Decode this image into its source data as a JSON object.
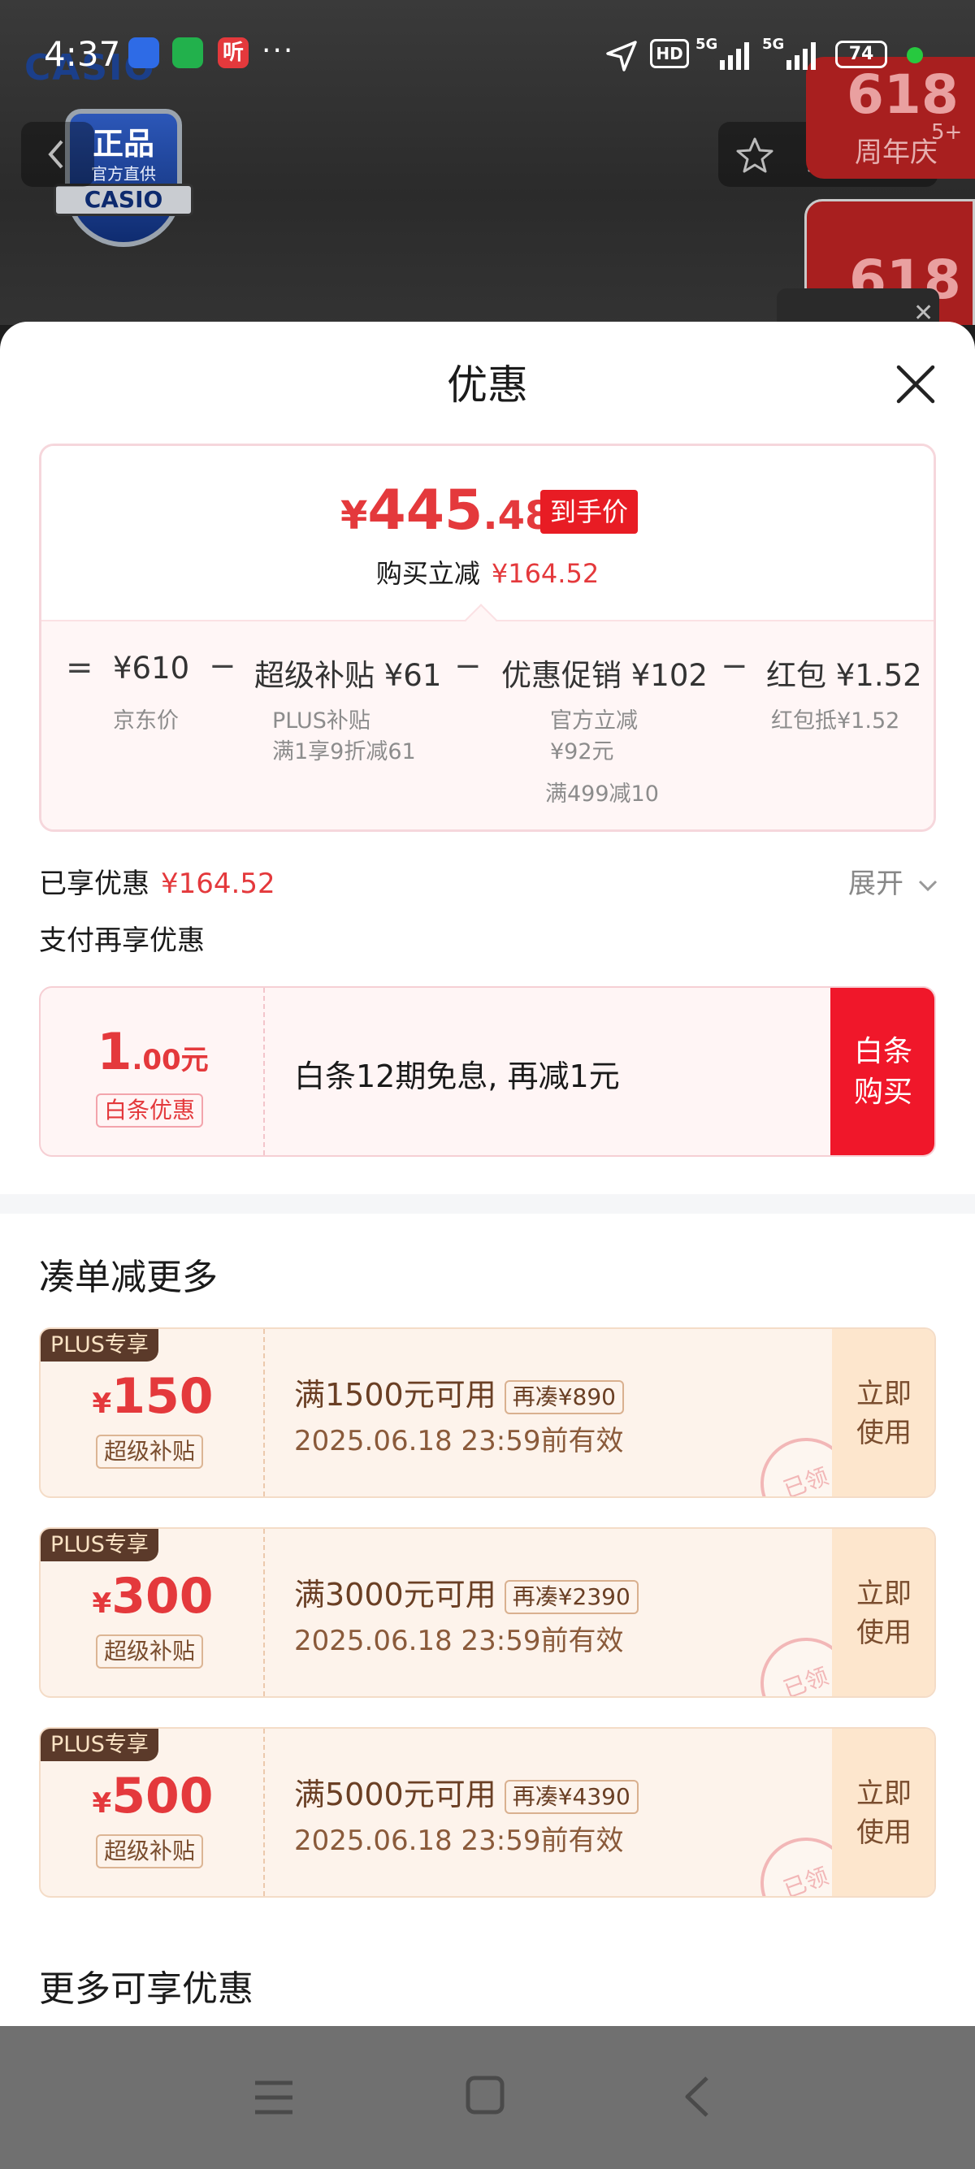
{
  "status_bar": {
    "time": "4:37",
    "hd_label": "HD",
    "network_1": "5G",
    "network_2": "5G",
    "battery": "74",
    "extra_icons": "···",
    "ting_icon_text": "听"
  },
  "background": {
    "brand_text": "CASIO",
    "badge_main": "正品",
    "badge_sub": "官方直供",
    "badge_brand": "CASIO",
    "promo_618_a": "618",
    "promo_618_a_label": "周年庆",
    "promo_618_a_badge": "5+",
    "promo_618_b": "618"
  },
  "sheet": {
    "title": "优惠"
  },
  "price_summary": {
    "currency": "¥",
    "final_int": "445",
    "final_dec": ".48",
    "final_tag": "到手价",
    "reduce_label": "购买立减",
    "reduce_amount": "¥164.52"
  },
  "breakdown": {
    "eq": "=",
    "minus": "−",
    "base_value": "¥610",
    "base_label": "京东价",
    "item1_title": "超级补贴 ¥61",
    "item1_sub1": "PLUS补贴",
    "item1_sub2": "满1享9折减61",
    "item2_title": "优惠促销 ¥102",
    "item2_sub1": "官方立减",
    "item2_sub2": "¥92元",
    "item2_sub3": "满499减10",
    "item3_title": "红包 ¥1.52",
    "item3_sub1": "红包抵¥1.52"
  },
  "enjoyed": {
    "label": "已享优惠",
    "amount": "¥164.52",
    "expand": "展开"
  },
  "pay_more": {
    "label": "支付再享优惠"
  },
  "baitiao": {
    "amount_int": "1",
    "amount_dec": ".00元",
    "tag": "白条优惠",
    "desc": "白条12期免息, 再减1元",
    "button_line1": "白条",
    "button_line2": "购买"
  },
  "combine_section": {
    "title": "凑单减更多"
  },
  "coupons": [
    {
      "plus_tag": "PLUS专享",
      "symbol": "¥",
      "value": "150",
      "tag": "超级补贴",
      "condition": "满1500元可用",
      "extra": "再凑¥890",
      "valid": "2025.06.18 23:59前有效",
      "button_line1": "立即",
      "button_line2": "使用",
      "stamp": "已领"
    },
    {
      "plus_tag": "PLUS专享",
      "symbol": "¥",
      "value": "300",
      "tag": "超级补贴",
      "condition": "满3000元可用",
      "extra": "再凑¥2390",
      "valid": "2025.06.18 23:59前有效",
      "button_line1": "立即",
      "button_line2": "使用",
      "stamp": "已领"
    },
    {
      "plus_tag": "PLUS专享",
      "symbol": "¥",
      "value": "500",
      "tag": "超级补贴",
      "condition": "满5000元可用",
      "extra": "再凑¥4390",
      "valid": "2025.06.18 23:59前有效",
      "button_line1": "立即",
      "button_line2": "使用",
      "stamp": "已领"
    }
  ],
  "more_section": {
    "title": "更多可享优惠"
  },
  "colors": {
    "accent_red": "#e4393c",
    "button_red": "#f0172a",
    "coupon_bg": "#fdf3eb",
    "plus_tag_bg": "#5b3a2a"
  }
}
